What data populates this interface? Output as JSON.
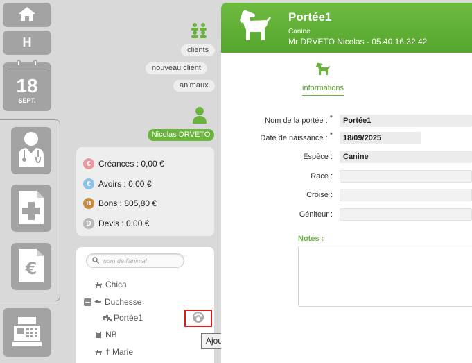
{
  "sidebar": {
    "home_icon": "home-icon",
    "h_label": "H",
    "calendar": {
      "day": "18",
      "month": "SEPT."
    },
    "icons": [
      "doctor-icon",
      "medical-record-icon",
      "invoice-euro-icon",
      "cash-register-icon"
    ]
  },
  "links": {
    "clients": "clients",
    "new_client": "nouveau client",
    "animals": "animaux"
  },
  "user": {
    "name": "Nicolas DRVETO"
  },
  "finance": [
    {
      "coin": "€",
      "label": "Créances : 0,00 €",
      "color": "#e89aa0"
    },
    {
      "coin": "€",
      "label": "Avoirs : 0,00 €",
      "color": "#8cc2e6"
    },
    {
      "coin": "B",
      "label": "Bons : 805,80 €",
      "color": "#c88a3e"
    },
    {
      "coin": "D",
      "label": "Devis : 0,00 €",
      "color": "#b8b8b8"
    }
  ],
  "tree": {
    "search_placeholder": "nom de l'animal",
    "items": [
      {
        "label": "Chica"
      },
      {
        "label": "Duchesse"
      },
      {
        "label": "Portée1"
      },
      {
        "label": "NB"
      },
      {
        "label": "† Marie"
      }
    ],
    "tooltip": "Ajouter un descendant"
  },
  "record": {
    "title": "Portée1",
    "species": "Canine",
    "owner": "Mr DRVETO Nicolas - 05.40.16.32.42",
    "tab": "informations",
    "fields": [
      {
        "label": "Nom de la portée :",
        "required": "*",
        "value": "Portée1"
      },
      {
        "label": "Date de naissance :",
        "required": "*",
        "value": "18/09/2025"
      },
      {
        "label": "Espèce :",
        "required": "",
        "value": "Canine"
      },
      {
        "label": "Race :",
        "required": "",
        "value": ""
      },
      {
        "label": "Croisé :",
        "required": "",
        "value": ""
      },
      {
        "label": "Géniteur :",
        "required": "",
        "value": ""
      }
    ],
    "notes_label": "Notes :",
    "notes_value": ""
  },
  "colors": {
    "accent": "#6bb33f",
    "highlight": "#d62020",
    "sidebar": "#a3a3a3"
  }
}
